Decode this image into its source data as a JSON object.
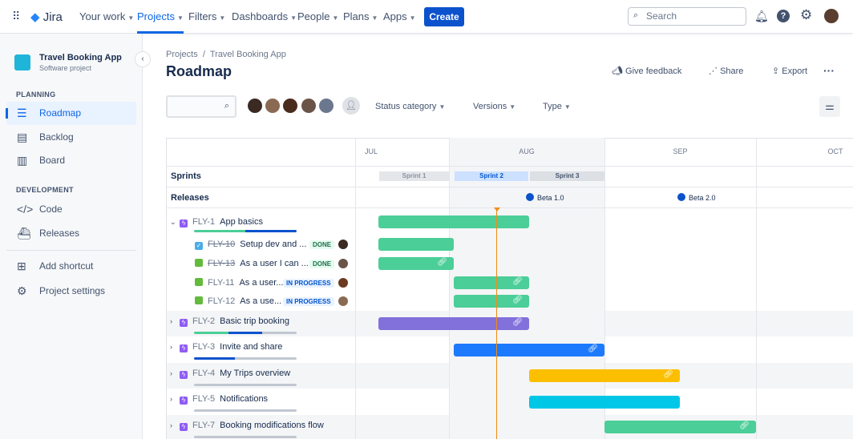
{
  "topbar": {
    "logo": "Jira",
    "nav": [
      {
        "label": "Your work"
      },
      {
        "label": "Projects",
        "active": true
      },
      {
        "label": "Filters"
      },
      {
        "label": "Dashboards"
      },
      {
        "label": "People"
      },
      {
        "label": "Plans"
      },
      {
        "label": "Apps"
      }
    ],
    "create": "Create",
    "search_placeholder": "Search"
  },
  "sidebar": {
    "project_name": "Travel Booking App",
    "project_type": "Software project",
    "planning_heading": "PLANNING",
    "planning": [
      {
        "label": "Roadmap",
        "selected": true
      },
      {
        "label": "Backlog"
      },
      {
        "label": "Board"
      }
    ],
    "development_heading": "DEVELOPMENT",
    "development": [
      {
        "label": "Code"
      },
      {
        "label": "Releases"
      }
    ],
    "add_shortcut": "Add shortcut",
    "project_settings": "Project settings"
  },
  "page": {
    "breadcrumb": [
      "Projects",
      "Travel Booking App"
    ],
    "title": "Roadmap",
    "actions": {
      "feedback": "Give feedback",
      "share": "Share",
      "export": "Export"
    },
    "filters": [
      "Status category",
      "Versions",
      "Type"
    ]
  },
  "timeline": {
    "months": [
      "JUL",
      "AUG",
      "SEP",
      "OCT"
    ],
    "sprints_label": "Sprints",
    "releases_label": "Releases",
    "sprints": [
      "Sprint 1",
      "Sprint 2",
      "Sprint 3"
    ],
    "releases": [
      "Beta 1.0",
      "Beta 2.0"
    ],
    "colors": {
      "green": "#4bce97",
      "purple": "#8270db",
      "blue": "#1d7afc",
      "yellow": "#fcbf00",
      "cyan": "#00c7e6",
      "today": "#f18d13"
    },
    "rows": [
      {
        "key": "FLY-1",
        "title": "App basics",
        "type": "epic",
        "expanded": true
      },
      {
        "key": "FLY-10",
        "title": "Setup dev and ...",
        "type": "task",
        "status": "DONE"
      },
      {
        "key": "FLY-13",
        "title": "As a user I can ...",
        "type": "story",
        "status": "DONE"
      },
      {
        "key": "FLY-11",
        "title": "As a user...",
        "type": "story",
        "status": "IN PROGRESS"
      },
      {
        "key": "FLY-12",
        "title": "As a use...",
        "type": "story",
        "status": "IN PROGRESS"
      },
      {
        "key": "FLY-2",
        "title": "Basic trip booking",
        "type": "epic"
      },
      {
        "key": "FLY-3",
        "title": "Invite and share",
        "type": "epic"
      },
      {
        "key": "FLY-4",
        "title": "My Trips overview",
        "type": "epic"
      },
      {
        "key": "FLY-5",
        "title": "Notifications",
        "type": "epic"
      },
      {
        "key": "FLY-7",
        "title": "Booking modifications flow",
        "type": "epic"
      }
    ]
  }
}
